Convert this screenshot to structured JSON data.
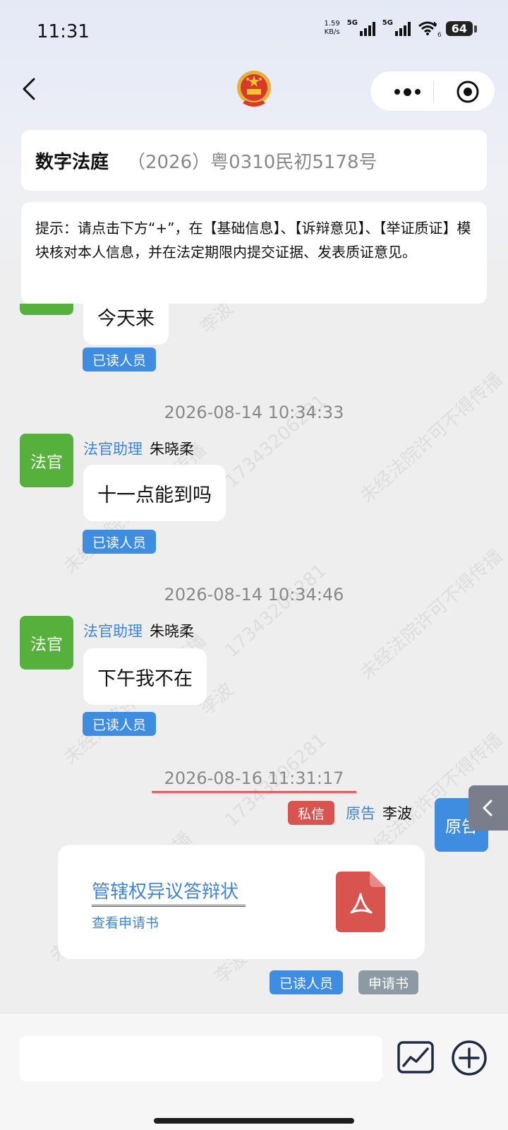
{
  "status_bar": {
    "time": "11:31",
    "net_speed_value": "1.59",
    "net_speed_unit": "KB/s",
    "signal1_label": "5G",
    "signal2_label": "5G",
    "wifi_badge": "6",
    "battery": "64"
  },
  "nav": {
    "back_icon": "chevron-left-icon",
    "emblem_icon": "national-emblem-icon",
    "more_icon": "more-dots-icon",
    "record_icon": "record-circle-icon"
  },
  "title_card": {
    "title": "数字法庭",
    "case_number": "（2026）粤0310民初5178号"
  },
  "tip": {
    "text": "提示：请点击下方“+”，在【基础信息】、【诉辩意见】、【举证质证】模块核对本人信息，并在法定期限内提交证据、发表质证意见。"
  },
  "messages": [
    {
      "bubble": "今天来",
      "read_tag": "已读人员"
    },
    {
      "timestamp": "2026-08-14 10:34:33",
      "avatar": "法官",
      "role": "法官助理",
      "name": "朱晓柔",
      "bubble": "十一点能到吗",
      "read_tag": "已读人员"
    },
    {
      "timestamp": "2026-08-14 10:34:46",
      "avatar": "法官",
      "role": "法官助理",
      "name": "朱晓柔",
      "bubble": "下午我不在",
      "read_tag": "已读人员"
    },
    {
      "timestamp": "2026-08-16 11:31:17",
      "avatar": "原告",
      "private_tag": "私信",
      "role": "原告",
      "name": "李波",
      "file_name": "管辖权异议答辩状",
      "file_sub": "查看申请书",
      "file_icon": "pdf-file-icon",
      "read_tag": "已读人员",
      "type_tag": "申请书"
    }
  ],
  "watermark": {
    "text": "未经法院许可不得传播",
    "phone": "17343206281",
    "name": "李波"
  },
  "colors": {
    "judge_green": "#56b13c",
    "plaintiff_blue": "#3f8de0",
    "link_blue": "#3f86d7",
    "private_red": "#d9534f",
    "tag_gray": "#8d9aa3"
  },
  "bottom_bar": {
    "input_value": "",
    "image_icon": "image-chart-icon",
    "plus_icon": "plus-circle-icon"
  }
}
